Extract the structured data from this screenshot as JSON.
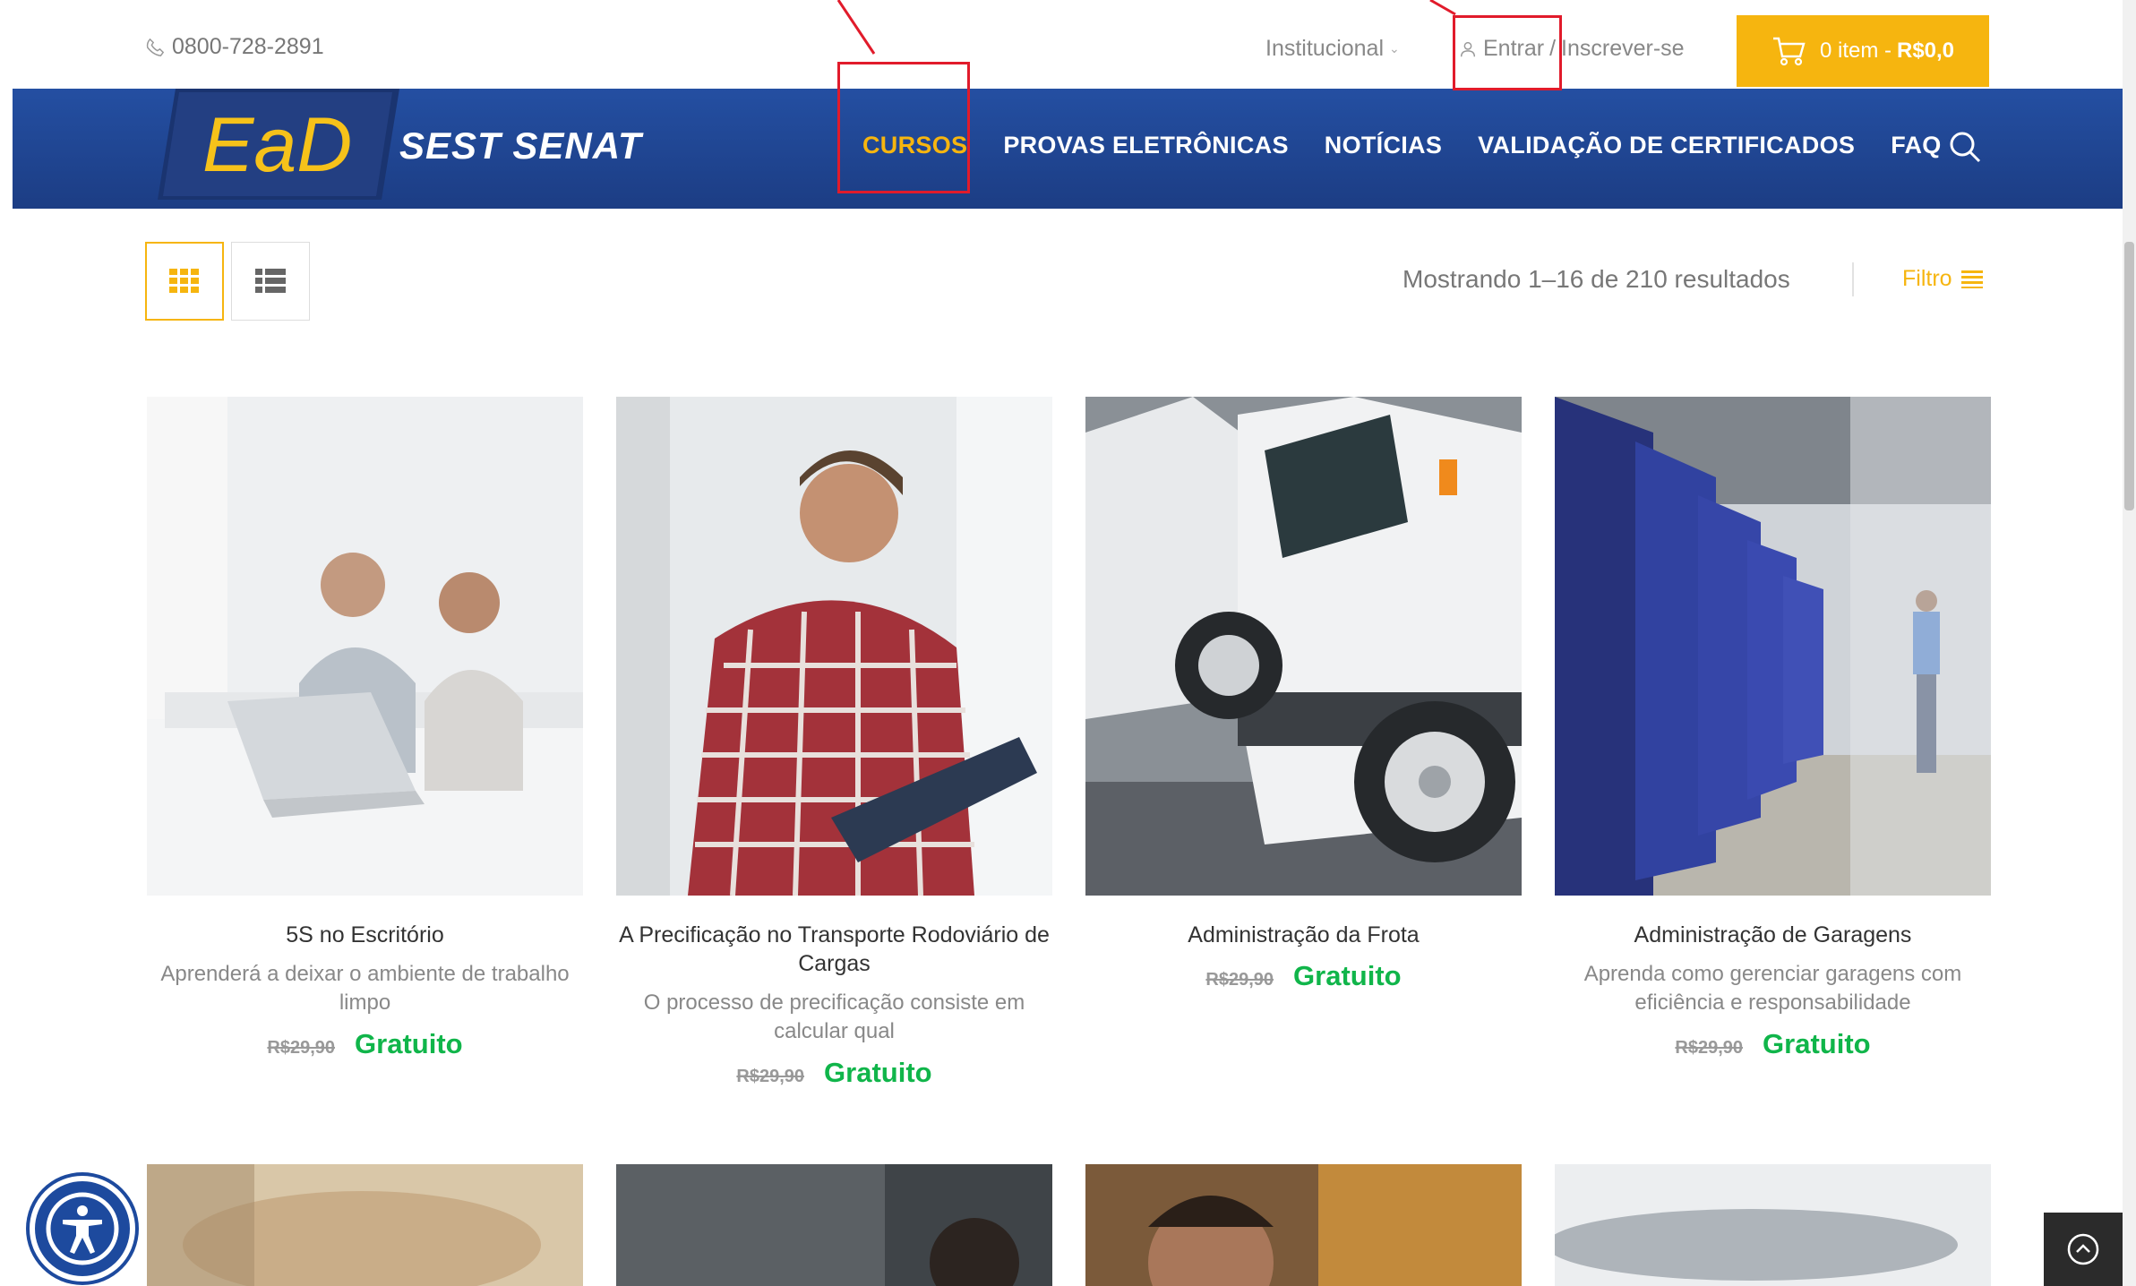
{
  "topbar": {
    "phone": "0800-728-2891",
    "institutional": "Institucional",
    "login": "Entrar",
    "login_sep": "/",
    "register": "Inscrever-se",
    "cart_items": "0 item -",
    "cart_total": "R$0,0"
  },
  "header": {
    "logo_text": "EaD",
    "brand": "SEST SENAT",
    "nav": [
      {
        "label": "CURSOS",
        "active": true
      },
      {
        "label": "PROVAS ELETRÔNICAS"
      },
      {
        "label": "NOTÍCIAS"
      },
      {
        "label": "VALIDAÇÃO DE CERTIFICADOS"
      },
      {
        "label": "FAQ"
      }
    ]
  },
  "toolbar": {
    "results": "Mostrando 1–16 de 210 resultados",
    "filter": "Filtro"
  },
  "products": [
    {
      "title": "5S no Escritório",
      "desc": "Aprenderá a deixar o ambiente de trabalho limpo",
      "old_price": "R$29,90",
      "price": "Gratuito"
    },
    {
      "title": "A Precificação no Transporte Rodoviário de Cargas",
      "desc": "O processo de precificação consiste em calcular qual",
      "old_price": "R$29,90",
      "price": "Gratuito"
    },
    {
      "title": "Administração da Frota",
      "desc": "",
      "old_price": "R$29,90",
      "price": "Gratuito"
    },
    {
      "title": "Administração de Garagens",
      "desc": "Aprenda como gerenciar garagens com eficiência e responsabilidade",
      "old_price": "R$29,90",
      "price": "Gratuito"
    }
  ],
  "colors": {
    "accent": "#f6b50f",
    "header_blue": "#1f4592",
    "free_green": "#10b54a",
    "annotation_red": "#e11b2b"
  },
  "icons": [
    "phone-icon",
    "user-icon",
    "cart-icon",
    "search-icon",
    "grid-view-icon",
    "list-view-icon",
    "filter-icon",
    "accessibility-icon",
    "arrow-up-icon"
  ]
}
